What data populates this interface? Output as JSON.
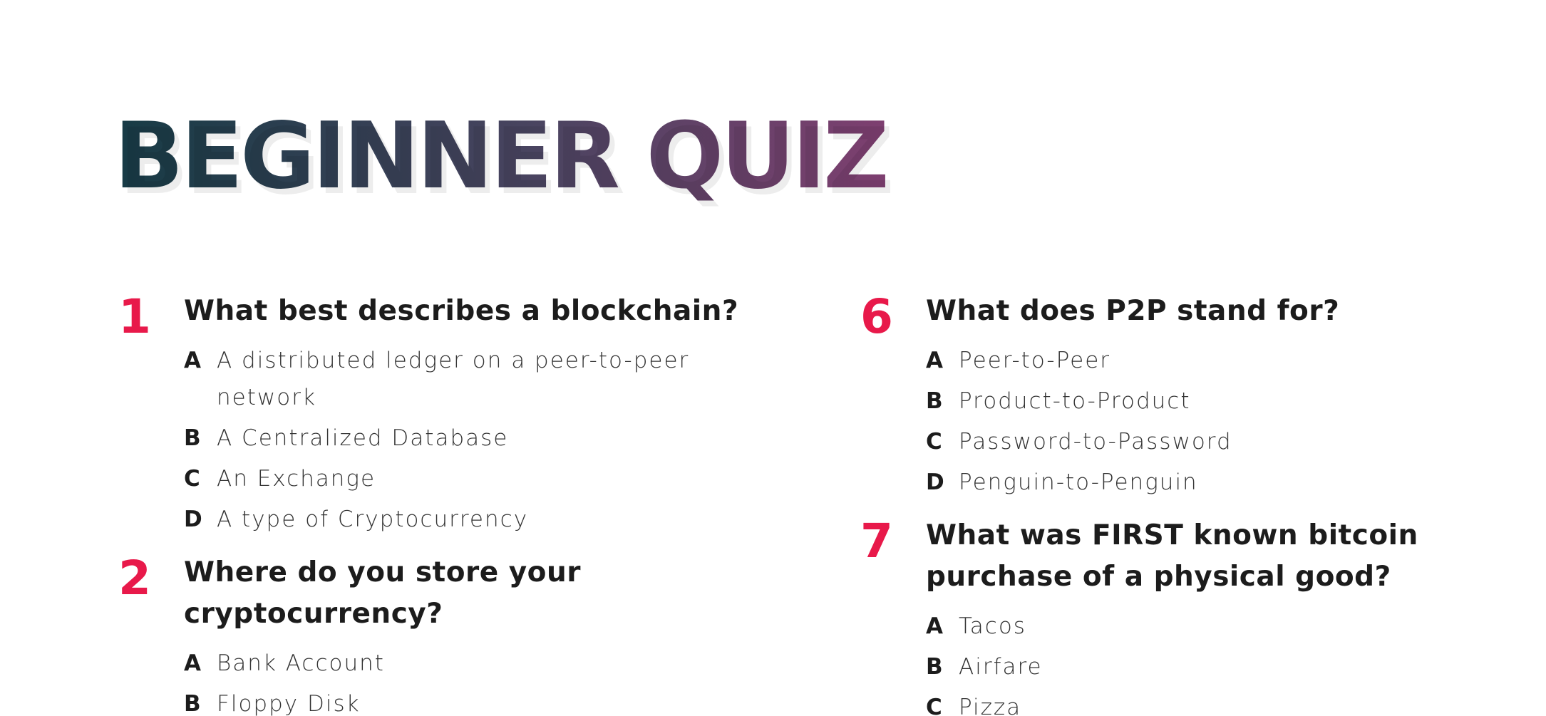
{
  "title": "BEGINNER QUIZ",
  "questions_left": [
    {
      "number": "1",
      "text": "What best describes a blockchain?",
      "options": [
        {
          "letter": "A",
          "text": "A distributed ledger on a peer-to-peer network"
        },
        {
          "letter": "B",
          "text": "A Centralized Database"
        },
        {
          "letter": "C",
          "text": "An Exchange"
        },
        {
          "letter": "D",
          "text": "A type of Cryptocurrency"
        }
      ]
    },
    {
      "number": "2",
      "text": "Where do you store your cryptocurrency?",
      "options": [
        {
          "letter": "A",
          "text": "Bank Account"
        },
        {
          "letter": "B",
          "text": "Floppy Disk"
        }
      ]
    }
  ],
  "questions_right": [
    {
      "number": "6",
      "text": "What does P2P stand for?",
      "options": [
        {
          "letter": "A",
          "text": "Peer-to-Peer"
        },
        {
          "letter": "B",
          "text": "Product-to-Product"
        },
        {
          "letter": "C",
          "text": "Password-to-Password"
        },
        {
          "letter": "D",
          "text": "Penguin-to-Penguin"
        }
      ]
    },
    {
      "number": "7",
      "text": "What was FIRST known bitcoin purchase of a physical good?",
      "options": [
        {
          "letter": "A",
          "text": "Tacos"
        },
        {
          "letter": "B",
          "text": "Airfare"
        },
        {
          "letter": "C",
          "text": "Pizza"
        }
      ]
    }
  ],
  "colors": {
    "number_accent": "#e8194a",
    "title_gradient_start": "#173b45",
    "title_gradient_end": "#7e3f70",
    "text": "#1c1c1c"
  }
}
